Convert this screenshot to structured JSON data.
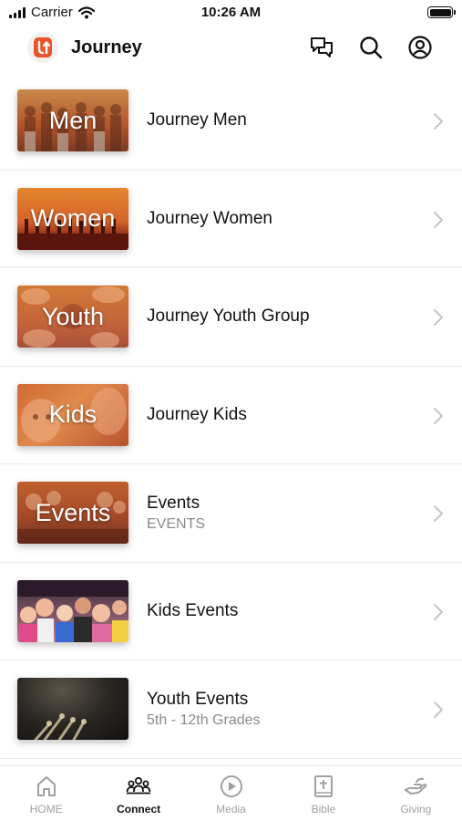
{
  "status_bar": {
    "carrier": "Carrier",
    "time": "10:26 AM"
  },
  "header": {
    "title": "Journey",
    "icons": [
      "chat-icon",
      "search-icon",
      "profile-icon"
    ]
  },
  "list": [
    {
      "thumb_label": "Men",
      "title": "Journey Men",
      "subtitle": ""
    },
    {
      "thumb_label": "Women",
      "title": "Journey Women",
      "subtitle": ""
    },
    {
      "thumb_label": "Youth",
      "title": "Journey Youth Group",
      "subtitle": ""
    },
    {
      "thumb_label": "Kids",
      "title": "Journey Kids",
      "subtitle": ""
    },
    {
      "thumb_label": "Events",
      "title": "Events",
      "subtitle": "EVENTS"
    },
    {
      "thumb_label": "",
      "title": "Kids Events",
      "subtitle": ""
    },
    {
      "thumb_label": "",
      "title": "Youth Events",
      "subtitle": "5th - 12th Grades"
    }
  ],
  "tabbar": [
    {
      "label": "HOME",
      "icon": "home-icon",
      "active": false
    },
    {
      "label": "Connect",
      "icon": "people-icon",
      "active": true
    },
    {
      "label": "Media",
      "icon": "play-icon",
      "active": false
    },
    {
      "label": "Bible",
      "icon": "bible-icon",
      "active": false
    },
    {
      "label": "Giving",
      "icon": "giving-hand-icon",
      "active": false
    }
  ],
  "colors": {
    "accent": "#e8552b",
    "active_tab": "#111111",
    "inactive_tab": "#a0a0a0"
  }
}
